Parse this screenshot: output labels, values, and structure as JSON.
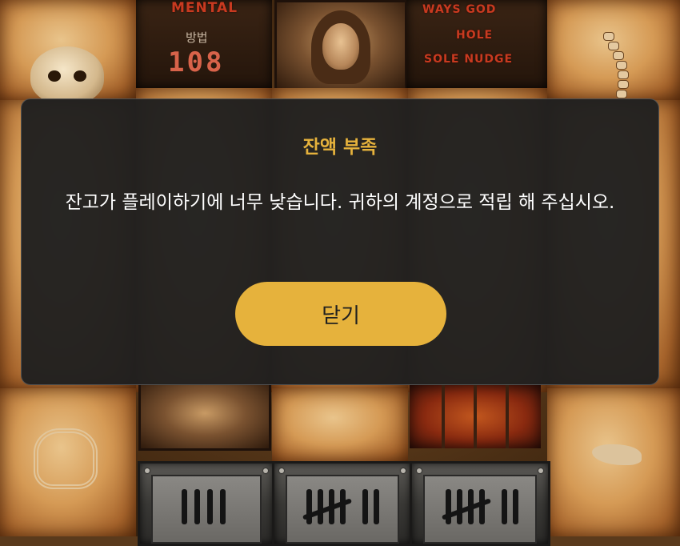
{
  "game": {
    "feature_banner": "MENTAL",
    "feature_sub": "방법",
    "feature_count": "108",
    "right_banner_lines": [
      "WAYS GOD",
      "HOLE",
      "SOLE NUDGE"
    ]
  },
  "dialog": {
    "title": "잔액 부족",
    "message": "잔고가 플레이하기에 너무 낮습니다. 귀하의 계정으로 적립 해 주십시오.",
    "close_label": "닫기"
  },
  "colors": {
    "accent": "#e6b23c",
    "dialog_bg": "#1f1f1f",
    "text": "#ffffff"
  },
  "icons": [
    "skull-icon",
    "spine-icon",
    "ribcage-icon",
    "foot-icon",
    "tally-marks-icon"
  ]
}
